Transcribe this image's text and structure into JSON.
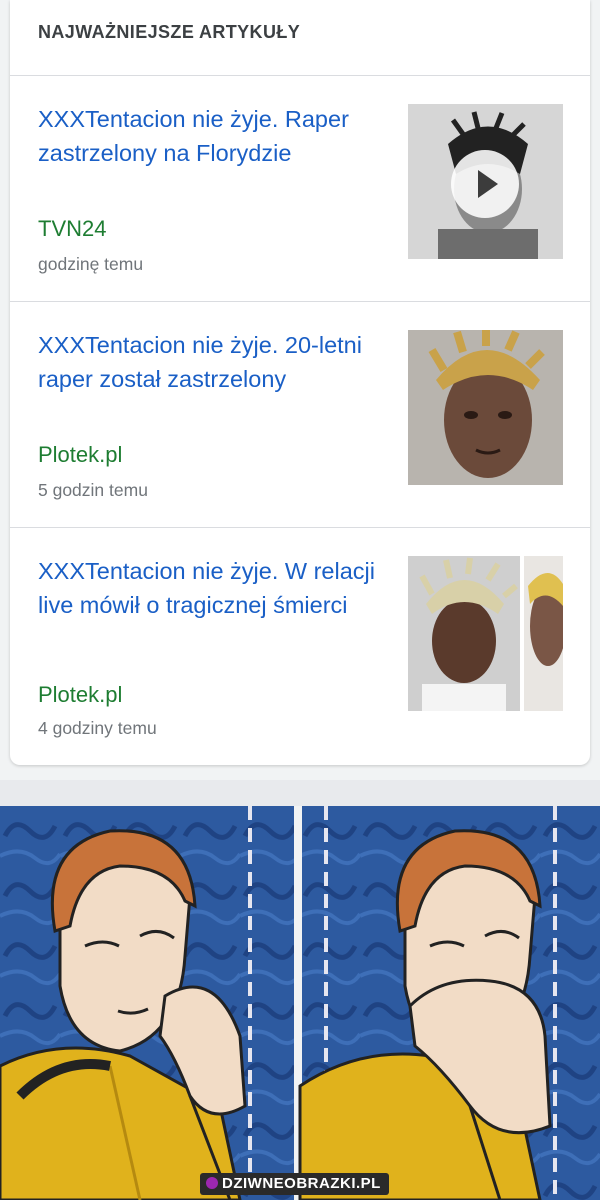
{
  "header": {
    "title": "NAJWAŻNIEJSZE ARTYKUŁY"
  },
  "articles": [
    {
      "title": "XXXTentacion nie żyje. Raper zastrzelony na Florydzie",
      "source": "TVN24",
      "time": "godzinę temu",
      "has_video": true
    },
    {
      "title": "XXXTentacion nie żyje. 20-letni raper został zastrzelony",
      "source": "Plotek.pl",
      "time": "5 godzin temu",
      "has_video": false
    },
    {
      "title": "XXXTentacion nie żyje. W relacji live mówił o tragicznej śmierci",
      "source": "Plotek.pl",
      "time": "4 godziny temu",
      "has_video": false
    }
  ],
  "watermark": {
    "text": "DZIWNEOBRAZKI.PL"
  },
  "colors": {
    "link": "#1a5fc6",
    "source": "#1e7d32",
    "time": "#70757a",
    "meme_bg": "#2d5aa0",
    "uniform": "#e0b21c"
  }
}
